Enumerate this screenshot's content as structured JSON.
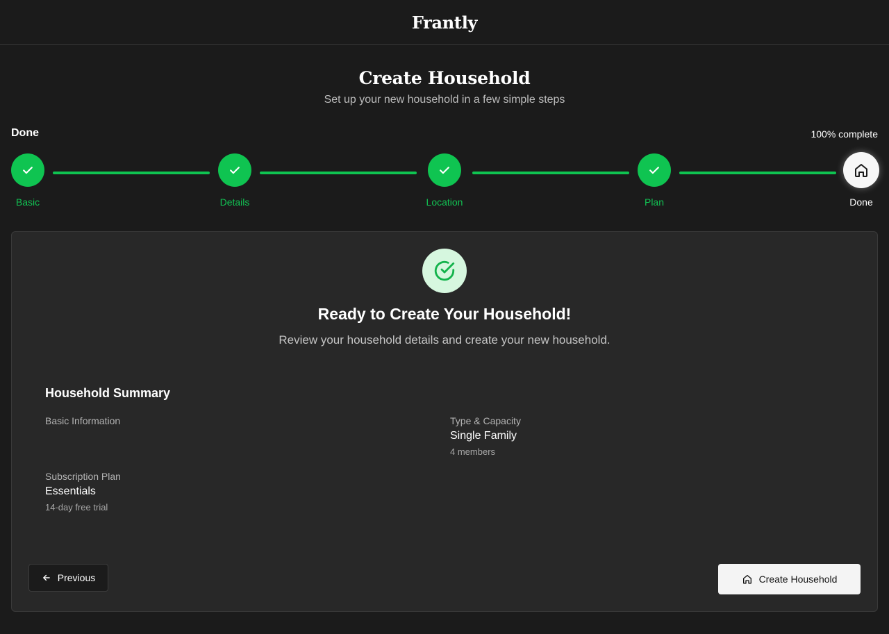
{
  "app": {
    "brand": "Frantly"
  },
  "page": {
    "title": "Create Household",
    "subtitle": "Set up your new household in a few simple steps"
  },
  "progress": {
    "current_step": "Done",
    "percent_label": "100% complete",
    "percent": 100,
    "steps": [
      {
        "label": "Basic",
        "status": "complete",
        "icon": "check-icon"
      },
      {
        "label": "Details",
        "status": "complete",
        "icon": "check-icon"
      },
      {
        "label": "Location",
        "status": "complete",
        "icon": "check-icon"
      },
      {
        "label": "Plan",
        "status": "complete",
        "icon": "check-icon"
      },
      {
        "label": "Done",
        "status": "active",
        "icon": "home-icon"
      }
    ]
  },
  "card": {
    "icon": "check-circle-icon",
    "title": "Ready to Create Your Household!",
    "subtitle": "Review your household details and create your new household.",
    "summary": {
      "title": "Household Summary",
      "basic_information": {
        "label": "Basic Information"
      },
      "type_capacity": {
        "label": "Type & Capacity",
        "value": "Single Family",
        "sub": "4 members"
      },
      "subscription_plan": {
        "label": "Subscription Plan",
        "value": "Essentials",
        "sub": "14-day free trial"
      }
    }
  },
  "actions": {
    "previous_label": "Previous",
    "create_label": "Create Household"
  },
  "colors": {
    "background": "#1b1b1b",
    "card": "#282828",
    "accent_green": "#0fc451",
    "badge_bg": "#d6f7df",
    "primary_button": "#f4f4f4"
  }
}
